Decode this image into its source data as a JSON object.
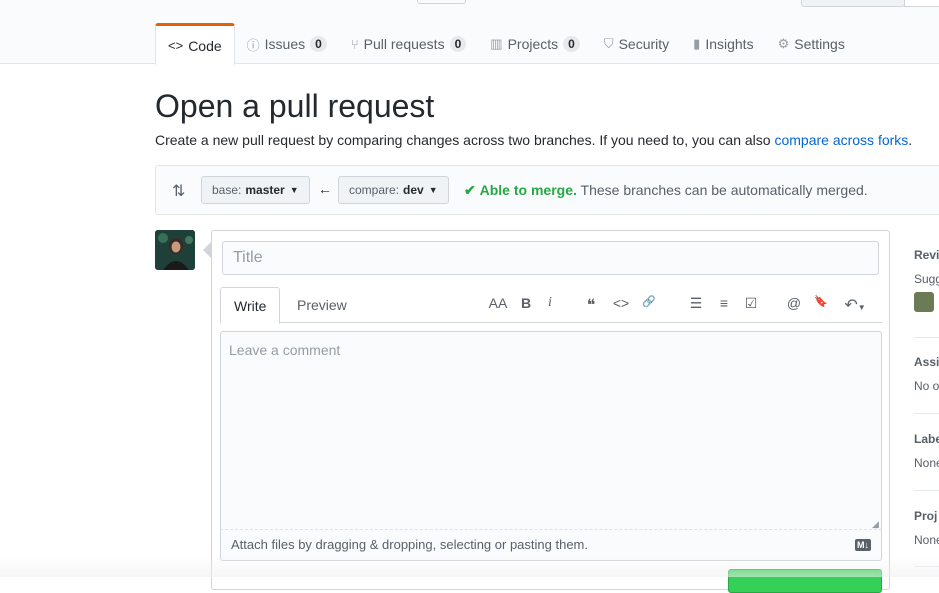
{
  "repo_nav": {
    "tabs": [
      {
        "label": "Code",
        "icon": "code-icon",
        "count": null,
        "selected": true
      },
      {
        "label": "Issues",
        "icon": "issue-icon",
        "count": "0",
        "selected": false
      },
      {
        "label": "Pull requests",
        "icon": "pull-request-icon",
        "count": "0",
        "selected": false
      },
      {
        "label": "Projects",
        "icon": "project-icon",
        "count": "0",
        "selected": false
      },
      {
        "label": "Security",
        "icon": "shield-icon",
        "count": null,
        "selected": false
      },
      {
        "label": "Insights",
        "icon": "graph-icon",
        "count": null,
        "selected": false
      },
      {
        "label": "Settings",
        "icon": "gear-icon",
        "count": null,
        "selected": false
      }
    ]
  },
  "page": {
    "title": "Open a pull request",
    "subtitle_prefix": "Create a new pull request by comparing changes across two branches. If you need to, you can also ",
    "subtitle_link": "compare across forks",
    "subtitle_suffix": "."
  },
  "range": {
    "base_label": "base:",
    "base_value": "master",
    "compare_label": "compare:",
    "compare_value": "dev",
    "merge_status": "Able to merge.",
    "merge_detail": "These branches can be automatically merged."
  },
  "form": {
    "title_placeholder": "Title",
    "write_tab": "Write",
    "preview_tab": "Preview",
    "comment_placeholder": "Leave a comment",
    "attach_text": "Attach files by dragging & dropping, selecting or pasting them.",
    "markdown_badge": "M↓"
  },
  "toolbar": {
    "heading": "AA",
    "bold": "B",
    "italic": "i",
    "quote": "❝",
    "code": "<>",
    "link": "🔗",
    "bullet_list": "☰",
    "numbered_list": "≡",
    "task_list": "☑",
    "mention": "@",
    "reference": "🔖",
    "reply": "↶"
  },
  "sidebar": {
    "reviewers_head": "Revi",
    "reviewers_val": "Sugg",
    "assignees_head": "Assi",
    "assignees_val": "No o",
    "labels_head": "Labe",
    "labels_val": "None",
    "projects_head": "Proj",
    "projects_val": "None"
  },
  "colors": {
    "accent_orange": "#e36209",
    "link_blue": "#0366d6",
    "merge_green": "#28a745",
    "submit_green": "#34d058"
  }
}
